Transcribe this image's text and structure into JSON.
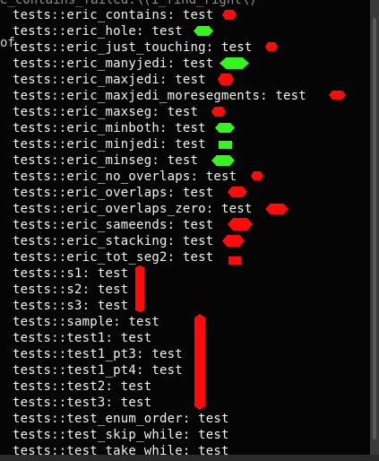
{
  "terminal": {
    "top_fragment": "e_contains_failed:\\(1_find_right\\)",
    "side_fragment": "of",
    "lines": [
      "tests::eric_contains: test",
      "tests::eric_hole: test",
      "tests::eric_just_touching: test",
      "tests::eric_manyjedi: test",
      "tests::eric_maxjedi: test",
      "tests::eric_maxjedi_moresegments: test",
      "tests::eric_maxseg: test",
      "tests::eric_minboth: test",
      "tests::eric_minjedi: test",
      "tests::eric_minseg: test",
      "tests::eric_no_overlaps: test",
      "tests::eric_overlaps: test",
      "tests::eric_overlaps_zero: test",
      "tests::eric_sameends: test",
      "tests::eric_stacking: test",
      "tests::eric_tot_seg2: test",
      "tests::s1: test",
      "tests::s2: test",
      "tests::s3: test",
      "tests::sample: test",
      "tests::test1: test",
      "tests::test1_pt3: test",
      "tests::test1_pt4: test",
      "tests::test2: test",
      "tests::test3: test",
      "tests::test_enum_order: test",
      "tests::test_skip_while: test",
      "tests::test_take_while: test"
    ]
  },
  "status_marks": [
    {
      "line": 0,
      "color": "#ff0b0b",
      "shape": "hexagon"
    },
    {
      "line": 1,
      "color": "#35f51f",
      "shape": "hexagon"
    },
    {
      "line": 2,
      "color": "#ff0b0b",
      "shape": "hexagon"
    },
    {
      "line": 3,
      "color": "#35f51f",
      "shape": "hexagon"
    },
    {
      "line": 4,
      "color": "#ff0b0b",
      "shape": "hexagon"
    },
    {
      "line": 5,
      "color": "#ff0b0b",
      "shape": "hexagon"
    },
    {
      "line": 6,
      "color": "#ff0b0b",
      "shape": "hexagon"
    },
    {
      "line": 7,
      "color": "#35f51f",
      "shape": "hexagon"
    },
    {
      "line": 8,
      "color": "#35f51f",
      "shape": "square"
    },
    {
      "line": 9,
      "color": "#35f51f",
      "shape": "hexagon"
    },
    {
      "line": 10,
      "color": "#ff0b0b",
      "shape": "hexagon"
    },
    {
      "line": 11,
      "color": "#ff0b0b",
      "shape": "hexagon"
    },
    {
      "line": 12,
      "color": "#ff0b0b",
      "shape": "hexagon"
    },
    {
      "line": 13,
      "color": "#ff0b0b",
      "shape": "hexagon"
    },
    {
      "line": 14,
      "color": "#ff0b0b",
      "shape": "hexagon"
    },
    {
      "line": 15,
      "color": "#ff0b0b",
      "shape": "square"
    },
    {
      "lines": [
        16,
        18
      ],
      "color": "#ff0b0b",
      "shape": "vertical-bar"
    },
    {
      "lines": [
        19,
        24
      ],
      "color": "#ff0b0b",
      "shape": "vertical-bar"
    }
  ]
}
